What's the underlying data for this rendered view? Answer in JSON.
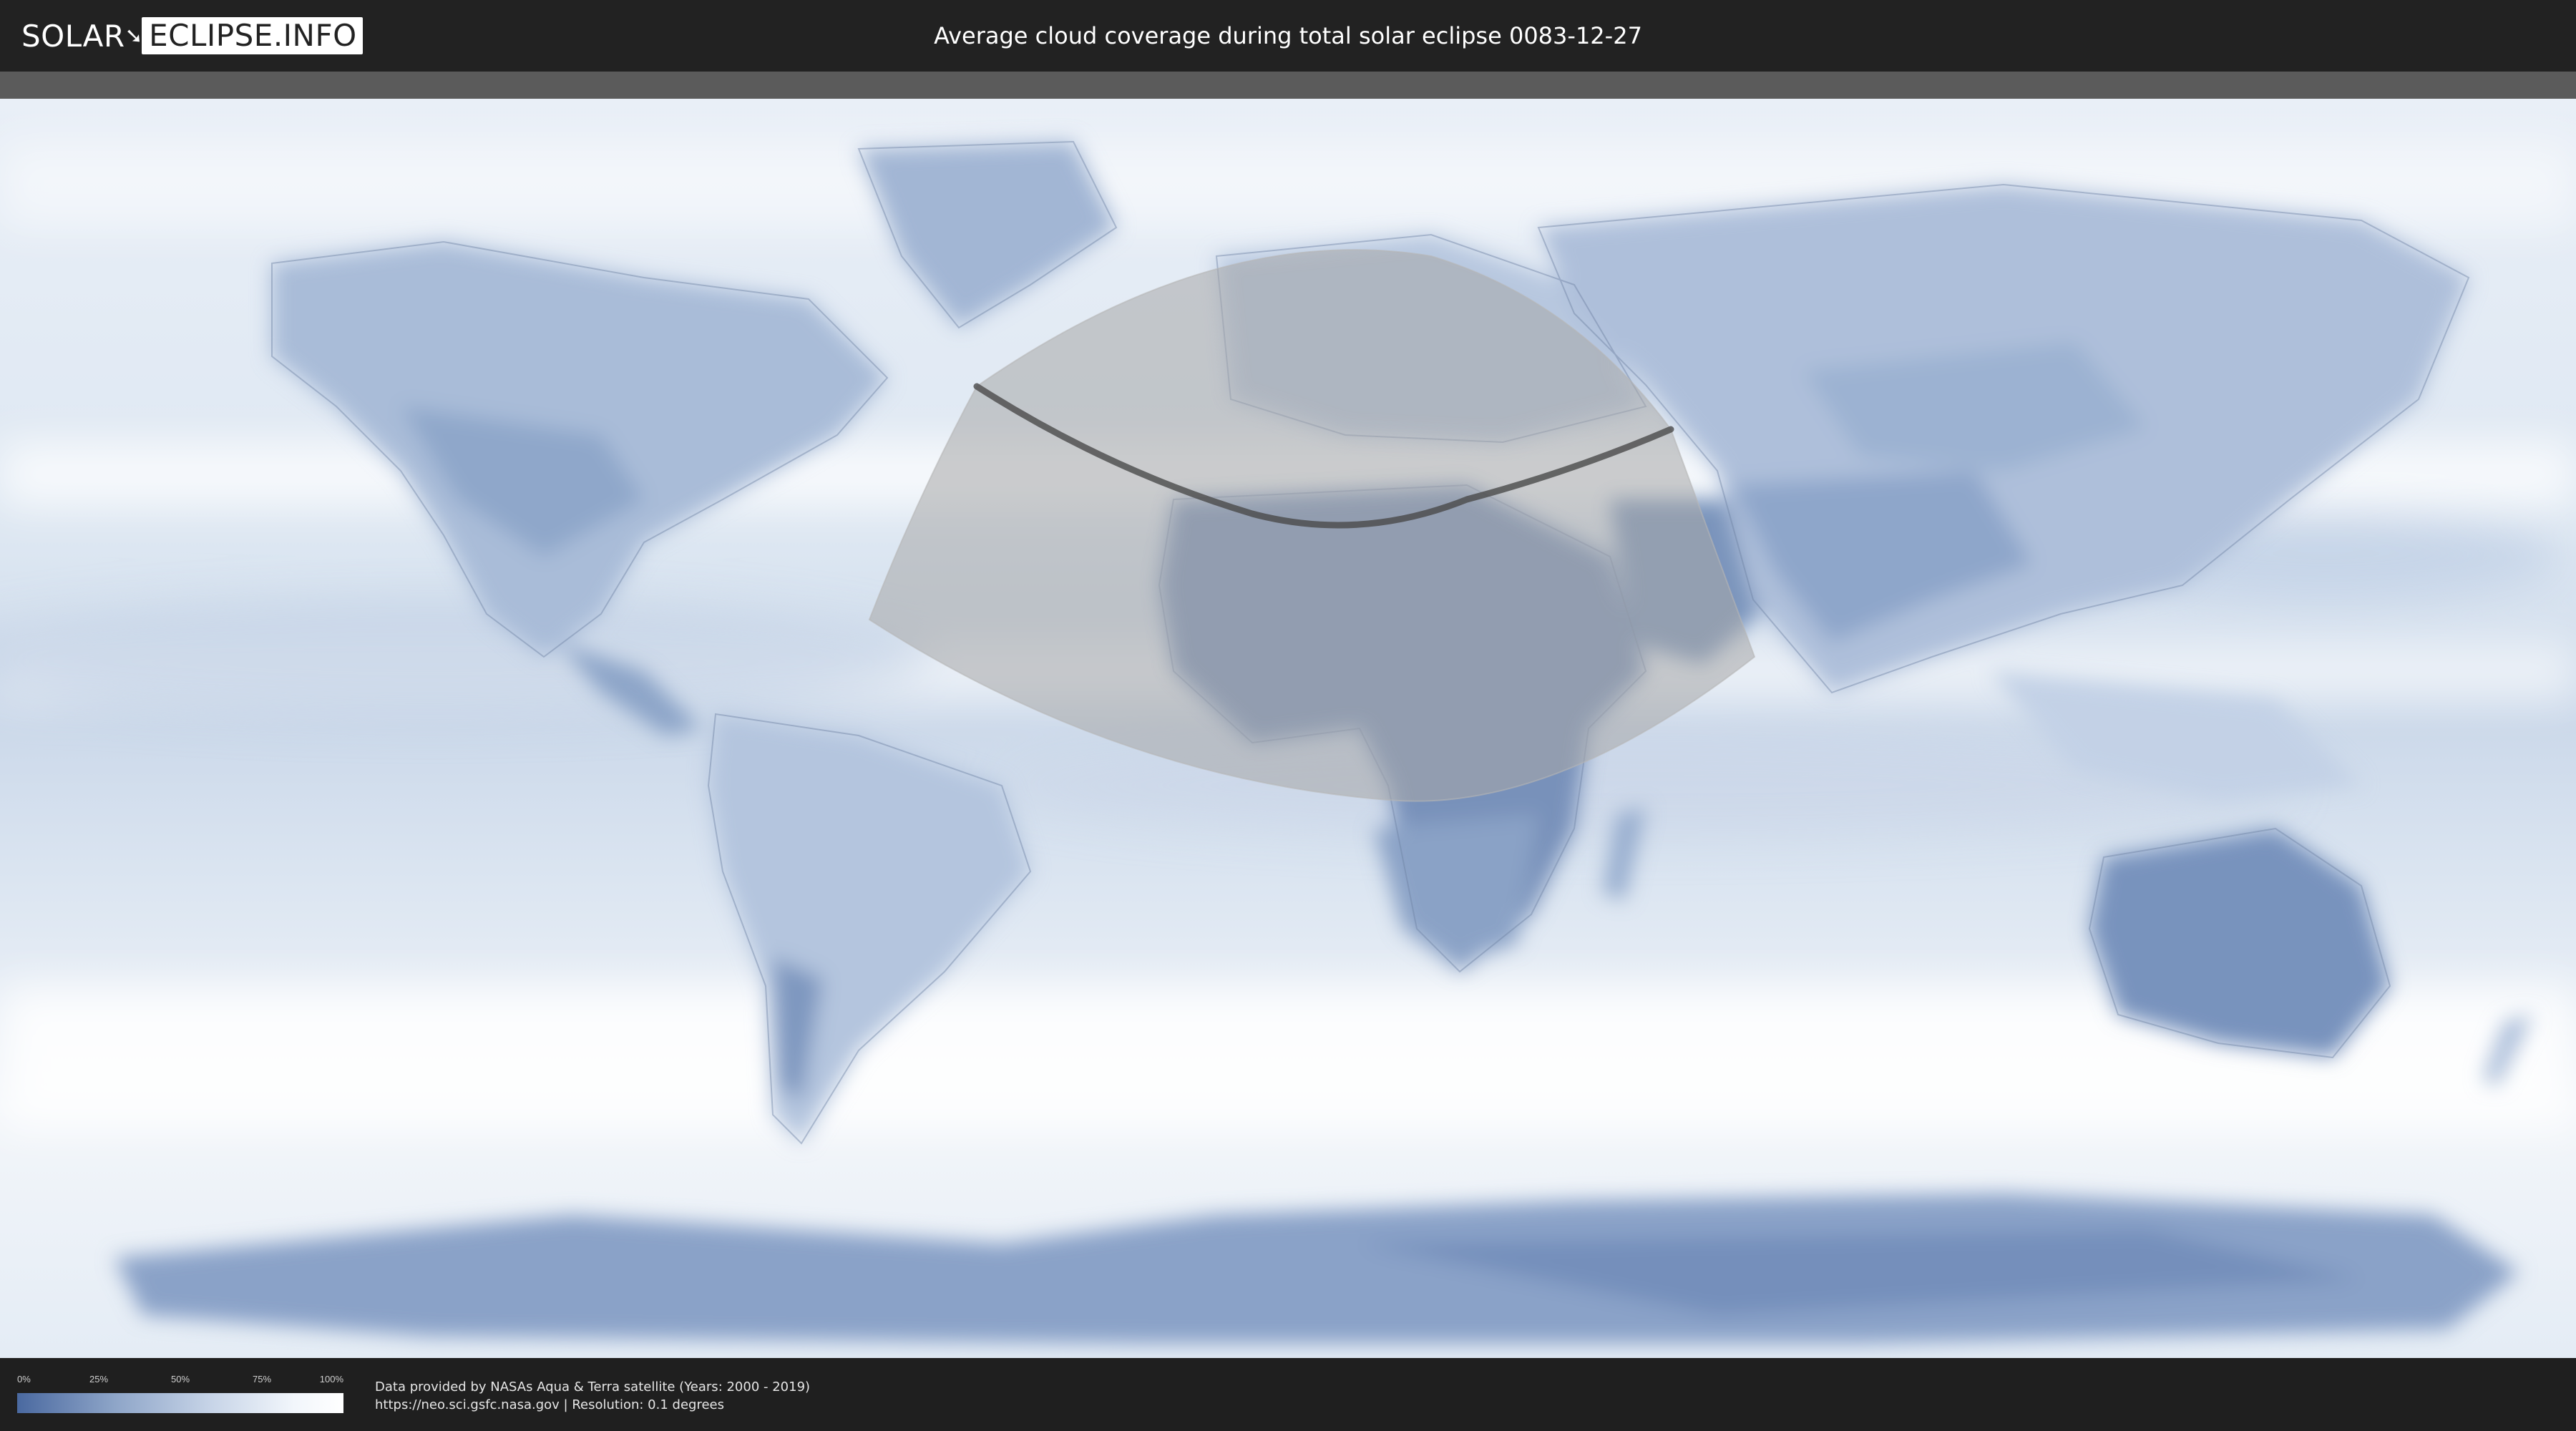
{
  "header": {
    "logo_left": "SOLAR",
    "logo_mark": "➘",
    "logo_right": "ECLIPSE.INFO",
    "title": "Average cloud coverage during total solar eclipse 0083-12-27"
  },
  "legend": {
    "ticks": [
      "0%",
      "25%",
      "50%",
      "75%",
      "100%"
    ],
    "color_low": "#4a69a0",
    "color_high": "#ffffff"
  },
  "credits": {
    "line1": "Data provided by NASAs Aqua & Terra satellite (Years: 2000 - 2019)",
    "line2": "https://neo.sci.gsfc.nasa.gov | Resolution: 0.1 degrees"
  },
  "colors": {
    "header_bg": "#222222",
    "ocean_cloud": "#eef3f9",
    "land_clear": "#7e97bf",
    "eclipse_zone": "#a7a7a7",
    "eclipse_path": "#4a4a4a"
  }
}
